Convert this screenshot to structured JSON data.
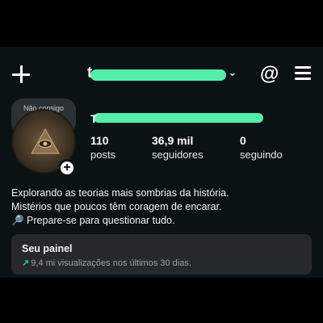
{
  "header": {
    "username": "t",
    "icons": [
      "plus-icon",
      "chevron-down-icon",
      "threads-icon",
      "menu-icon"
    ]
  },
  "profile": {
    "note": "Não consigo decidir...",
    "display_name": "T",
    "add_story_icon": "+",
    "stats": [
      {
        "value": "110",
        "label": "posts"
      },
      {
        "value": "36,9 mil",
        "label": "seguidores"
      },
      {
        "value": "0",
        "label": "seguindo"
      }
    ],
    "bio": [
      "Explorando as teorias mais sombrias da história.",
      "Mistérios que poucos têm coragem de encarar.",
      "🔎 Prepare-se para questionar tudo."
    ]
  },
  "dashboard": {
    "title": "Seu painel",
    "arrow": "↗",
    "subtitle": "9,4 mi visualizações nos últimos 30 dias."
  },
  "colors": {
    "background": "#0b1214",
    "redaction": "#4ff0a8",
    "dashboard_bg": "#25292c",
    "growth_arrow": "#3ecf83"
  }
}
